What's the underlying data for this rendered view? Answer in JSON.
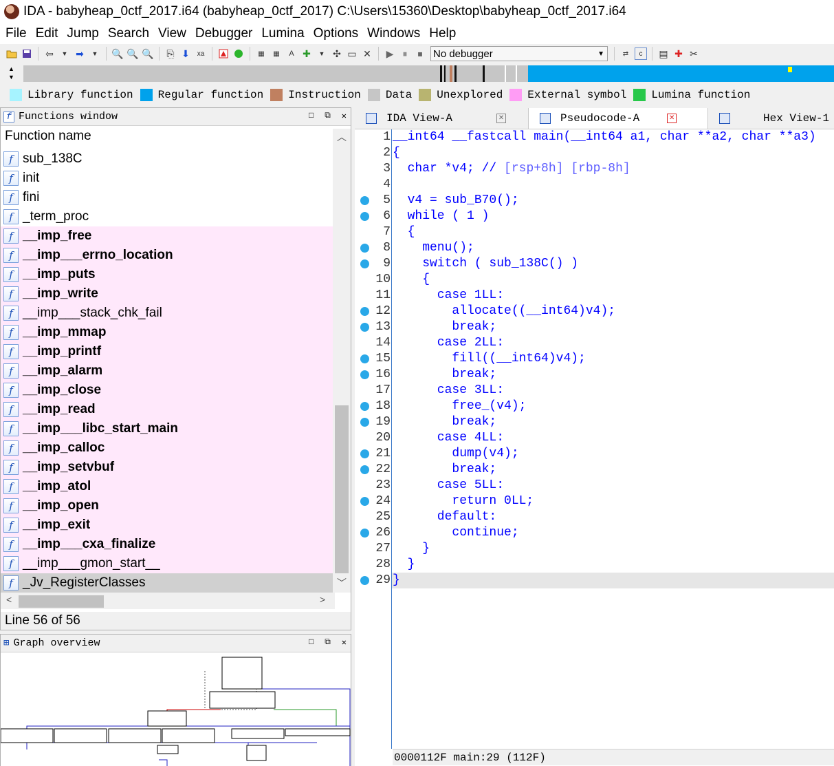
{
  "window": {
    "title": "IDA - babyheap_0ctf_2017.i64 (babyheap_0ctf_2017) C:\\Users\\15360\\Desktop\\babyheap_0ctf_2017.i64"
  },
  "menubar": {
    "items": [
      "File",
      "Edit",
      "Jump",
      "Search",
      "View",
      "Debugger",
      "Lumina",
      "Options",
      "Windows",
      "Help"
    ]
  },
  "toolbar": {
    "debugger_select": "No debugger",
    "icons": [
      "open-icon",
      "save-icon",
      "back-arrow-icon",
      "forward-arrow-icon",
      "binary-search-icon",
      "text-search-icon",
      "sequence-search-icon",
      "jump-icon",
      "down-arrow-icon",
      "hex-icon",
      "stop-icon",
      "green-light-icon",
      "code-icon",
      "data-icon",
      "string-icon",
      "patch-icon",
      "array-icon",
      "undefine-icon",
      "close-x-icon",
      "play-icon",
      "pause-icon",
      "stop-debug-icon",
      "trace-icon",
      "step-icon",
      "chart-icon",
      "breakpoint-icon",
      "cut-icon"
    ]
  },
  "legend": {
    "items": [
      {
        "label": "Library function",
        "color": "#a6f3ff"
      },
      {
        "label": "Regular function",
        "color": "#00a2ec"
      },
      {
        "label": "Instruction",
        "color": "#c08060"
      },
      {
        "label": "Data",
        "color": "#c6c6c6"
      },
      {
        "label": "Unexplored",
        "color": "#b8b470"
      },
      {
        "label": "External symbol",
        "color": "#ff9cf5"
      },
      {
        "label": "Lumina function",
        "color": "#27c84a"
      }
    ]
  },
  "functions_window": {
    "title": "Functions window",
    "column_header": "Function name",
    "functions": [
      {
        "name": "sub_138C",
        "style": "normal"
      },
      {
        "name": "init",
        "style": "normal"
      },
      {
        "name": "fini",
        "style": "normal"
      },
      {
        "name": "_term_proc",
        "style": "normal"
      },
      {
        "name": "__imp_free",
        "style": "imported-bold"
      },
      {
        "name": "__imp___errno_location",
        "style": "imported-bold"
      },
      {
        "name": "__imp_puts",
        "style": "imported-bold"
      },
      {
        "name": "__imp_write",
        "style": "imported-bold"
      },
      {
        "name": "__imp___stack_chk_fail",
        "style": "imported"
      },
      {
        "name": "__imp_mmap",
        "style": "imported-bold"
      },
      {
        "name": "__imp_printf",
        "style": "imported-bold"
      },
      {
        "name": "__imp_alarm",
        "style": "imported-bold"
      },
      {
        "name": "__imp_close",
        "style": "imported-bold"
      },
      {
        "name": "__imp_read",
        "style": "imported-bold"
      },
      {
        "name": "__imp___libc_start_main",
        "style": "imported-bold"
      },
      {
        "name": "__imp_calloc",
        "style": "imported-bold"
      },
      {
        "name": "__imp_setvbuf",
        "style": "imported-bold"
      },
      {
        "name": "__imp_atol",
        "style": "imported-bold"
      },
      {
        "name": "__imp_open",
        "style": "imported-bold"
      },
      {
        "name": "__imp_exit",
        "style": "imported-bold"
      },
      {
        "name": "__imp___cxa_finalize",
        "style": "imported-bold"
      },
      {
        "name": "__imp___gmon_start__",
        "style": "imported"
      },
      {
        "name": "_Jv_RegisterClasses",
        "style": "selected"
      }
    ],
    "status": "Line 56 of 56"
  },
  "graph_overview": {
    "title": "Graph overview"
  },
  "tabs": [
    {
      "label": "IDA View-A",
      "active": false
    },
    {
      "label": "Pseudocode-A",
      "active": true
    },
    {
      "label": "Hex View-1",
      "active": false
    }
  ],
  "pseudocode": {
    "lines": [
      {
        "n": "1",
        "dot": false,
        "text": "__int64 __fastcall main(__int64 a1, char **a2, char **a3)"
      },
      {
        "n": "2",
        "dot": false,
        "text": "{"
      },
      {
        "n": "3",
        "dot": false,
        "text": "  char *v4; // [rsp+8h] [rbp-8h]"
      },
      {
        "n": "4",
        "dot": false,
        "text": ""
      },
      {
        "n": "5",
        "dot": true,
        "text": "  v4 = sub_B70();"
      },
      {
        "n": "6",
        "dot": true,
        "text": "  while ( 1 )"
      },
      {
        "n": "7",
        "dot": false,
        "text": "  {"
      },
      {
        "n": "8",
        "dot": true,
        "text": "    menu();"
      },
      {
        "n": "9",
        "dot": true,
        "text": "    switch ( sub_138C() )"
      },
      {
        "n": "10",
        "dot": false,
        "text": "    {"
      },
      {
        "n": "11",
        "dot": false,
        "text": "      case 1LL:"
      },
      {
        "n": "12",
        "dot": true,
        "text": "        allocate((__int64)v4);"
      },
      {
        "n": "13",
        "dot": true,
        "text": "        break;"
      },
      {
        "n": "14",
        "dot": false,
        "text": "      case 2LL:"
      },
      {
        "n": "15",
        "dot": true,
        "text": "        fill((__int64)v4);"
      },
      {
        "n": "16",
        "dot": true,
        "text": "        break;"
      },
      {
        "n": "17",
        "dot": false,
        "text": "      case 3LL:"
      },
      {
        "n": "18",
        "dot": true,
        "text": "        free_(v4);"
      },
      {
        "n": "19",
        "dot": true,
        "text": "        break;"
      },
      {
        "n": "20",
        "dot": false,
        "text": "      case 4LL:"
      },
      {
        "n": "21",
        "dot": true,
        "text": "        dump(v4);"
      },
      {
        "n": "22",
        "dot": true,
        "text": "        break;"
      },
      {
        "n": "23",
        "dot": false,
        "text": "      case 5LL:"
      },
      {
        "n": "24",
        "dot": true,
        "text": "        return 0LL;"
      },
      {
        "n": "25",
        "dot": false,
        "text": "      default:"
      },
      {
        "n": "26",
        "dot": true,
        "text": "        continue;"
      },
      {
        "n": "27",
        "dot": false,
        "text": "    }"
      },
      {
        "n": "28",
        "dot": false,
        "text": "  }"
      },
      {
        "n": "29",
        "dot": true,
        "text": "}"
      }
    ],
    "current_line": "29",
    "status": "0000112F main:29 (112F)"
  }
}
